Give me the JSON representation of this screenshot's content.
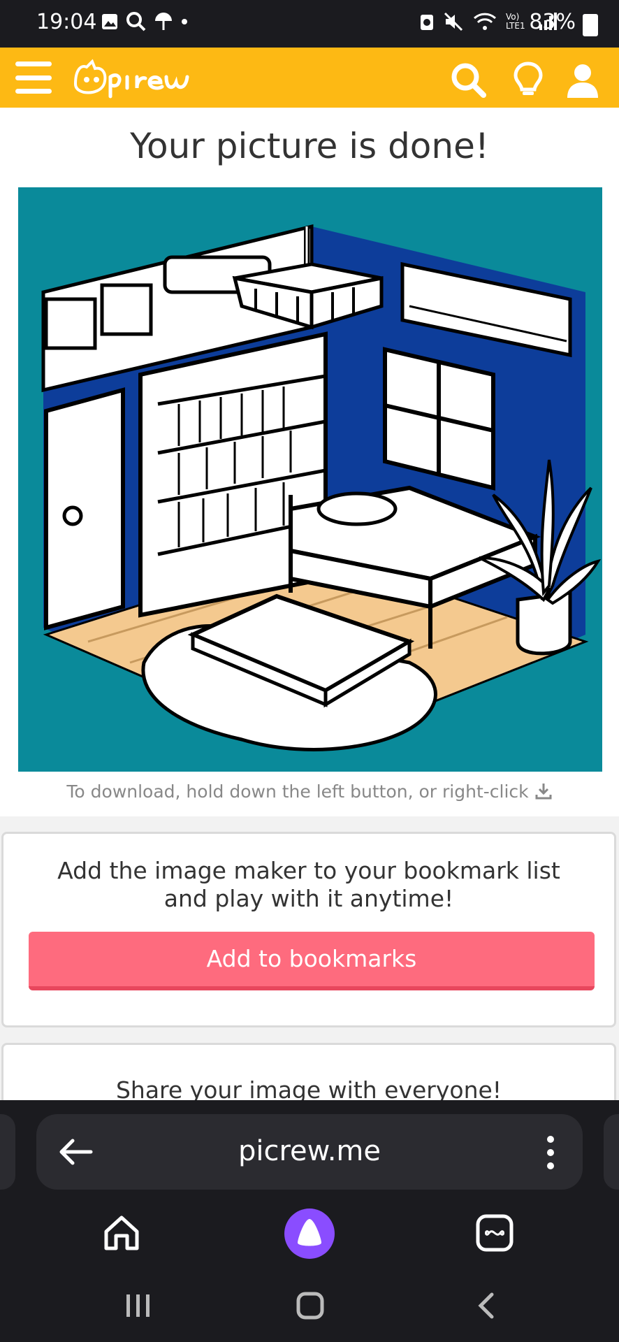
{
  "status_bar": {
    "time": "19:04",
    "battery": "83%",
    "network": "Vo) LTE1"
  },
  "header": {
    "logo_text": "Picrew"
  },
  "main": {
    "title": "Your picture is done!",
    "download_hint": "To download, hold down the left button, or right-click",
    "bookmark_card": {
      "text_line1": "Add the image maker to your bookmark list",
      "text_line2": "and play with it anytime!",
      "button_label": "Add to bookmarks"
    },
    "share_card": {
      "text": "Share your image with everyone!"
    }
  },
  "browser": {
    "url": "picrew.me"
  },
  "colors": {
    "header": "#fdb914",
    "button": "#fe6b7e",
    "image_bg": "#0a8a9a",
    "wall": "#0d3d9a",
    "floor": "#f4c98f"
  }
}
